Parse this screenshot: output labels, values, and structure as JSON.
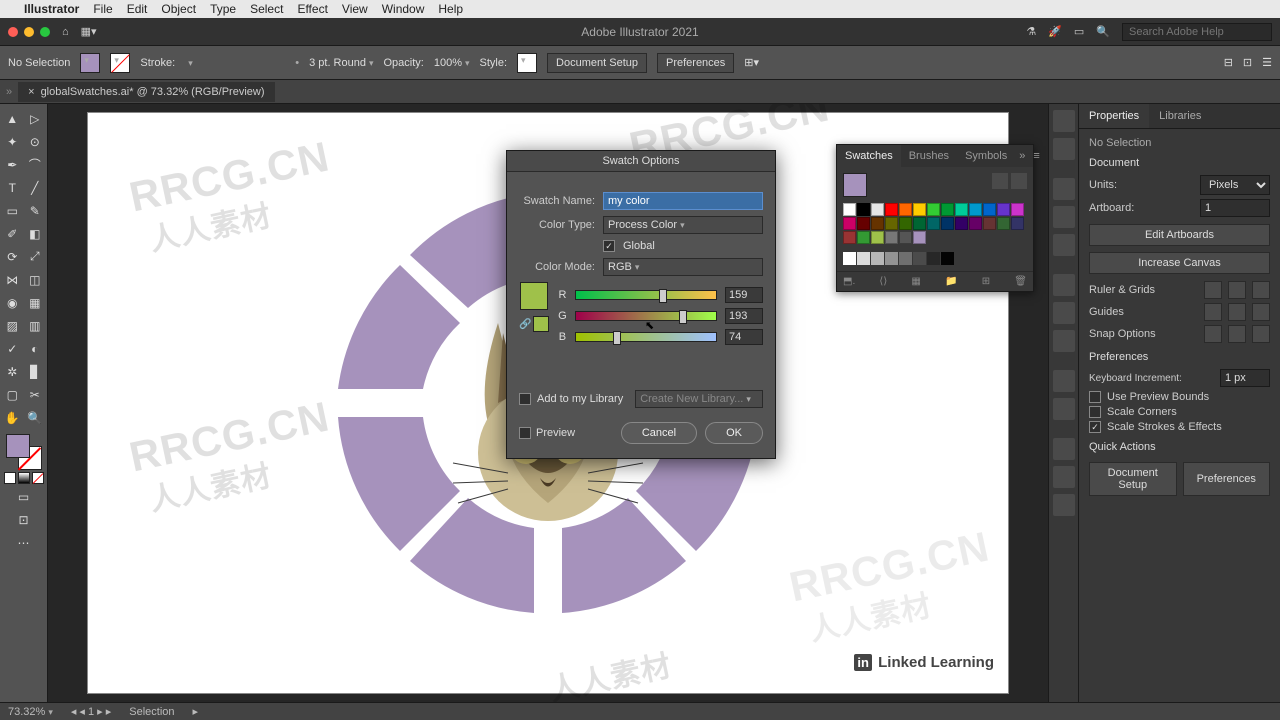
{
  "mac_menu": {
    "apple": "",
    "app": "Illustrator",
    "items": [
      "File",
      "Edit",
      "Object",
      "Type",
      "Select",
      "Effect",
      "View",
      "Window",
      "Help"
    ]
  },
  "app_bar": {
    "title": "Adobe Illustrator 2021",
    "help_placeholder": "Search Adobe Help"
  },
  "control": {
    "selection": "No Selection",
    "stroke_label": "Stroke:",
    "stroke_pt": "3 pt. Round",
    "opacity_label": "Opacity:",
    "opacity_val": "100%",
    "style_label": "Style:",
    "doc_setup": "Document Setup",
    "prefs": "Preferences"
  },
  "doc_tab": {
    "name": "globalSwatches.ai* @ 73.32% (RGB/Preview)"
  },
  "swatches_panel": {
    "tabs": [
      "Swatches",
      "Brushes",
      "Symbols"
    ],
    "colors_row1": [
      "#ffffff",
      "#000000",
      "#e6e6e6",
      "#ff0000",
      "#ff6600",
      "#ffcc00",
      "#33cc33",
      "#009933",
      "#00cc99",
      "#0099cc",
      "#0066cc",
      "#6633cc",
      "#cc33cc",
      "#cc0066"
    ],
    "colors_row2": [
      "#660000",
      "#663300",
      "#666600",
      "#336600",
      "#006633",
      "#006666",
      "#003366",
      "#330066",
      "#660066",
      "#663333",
      "#336633",
      "#333366",
      "#993333",
      "#339933"
    ],
    "colors_row3": [
      "#9fc14a",
      "#777777",
      "#555555",
      "#a692bc"
    ]
  },
  "dialog": {
    "title": "Swatch Options",
    "swatch_name_label": "Swatch Name:",
    "swatch_name_val": "my color",
    "color_type_label": "Color Type:",
    "color_type_val": "Process Color",
    "global_label": "Global",
    "color_mode_label": "Color Mode:",
    "color_mode_val": "RGB",
    "r": {
      "label": "R",
      "val": "159",
      "pct": 62
    },
    "g": {
      "label": "G",
      "val": "193",
      "pct": 76
    },
    "b": {
      "label": "B",
      "val": "74",
      "pct": 29
    },
    "add_lib_label": "Add to my Library",
    "create_lib": "Create New Library...",
    "preview_label": "Preview",
    "cancel": "Cancel",
    "ok": "OK"
  },
  "props": {
    "tabs": [
      "Properties",
      "Libraries"
    ],
    "no_sel": "No Selection",
    "document": "Document",
    "units_label": "Units:",
    "units_val": "Pixels",
    "artboard_label": "Artboard:",
    "artboard_val": "1",
    "edit_artboards": "Edit Artboards",
    "increase_canvas": "Increase Canvas",
    "ruler_grids": "Ruler & Grids",
    "guides": "Guides",
    "snap_options": "Snap Options",
    "preferences": "Preferences",
    "key_inc_label": "Keyboard Increment:",
    "key_inc_val": "1 px",
    "use_preview": "Use Preview Bounds",
    "scale_corners": "Scale Corners",
    "scale_strokes": "Scale Strokes & Effects",
    "quick_actions": "Quick Actions",
    "qa_doc_setup": "Document Setup",
    "qa_prefs": "Preferences"
  },
  "status": {
    "zoom": "73.32%",
    "artboard": "1",
    "tool": "Selection"
  },
  "watermarks": {
    "en": "RRCG.CN",
    "cn": "人人素材"
  },
  "linkedin": "Linked    Learning"
}
